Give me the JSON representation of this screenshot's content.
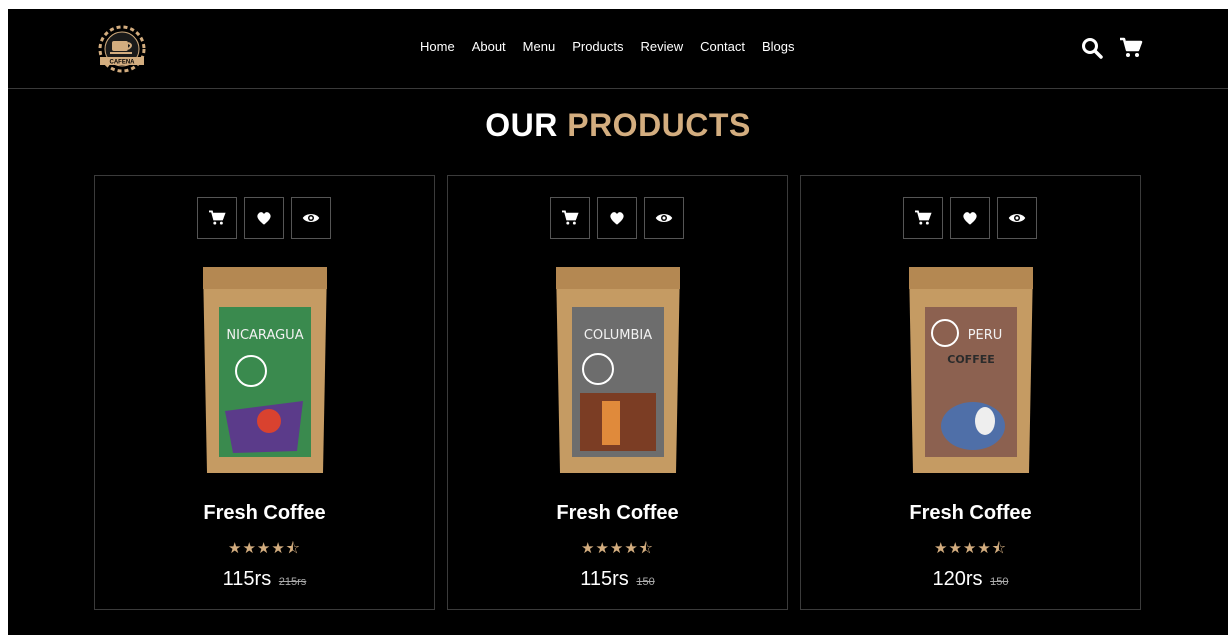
{
  "header": {
    "logo_text": "CAFENA",
    "nav": [
      "Home",
      "About",
      "Menu",
      "Products",
      "Review",
      "Contact",
      "Blogs"
    ]
  },
  "section": {
    "title_part1": "OUR",
    "title_part2": "PRODUCTS"
  },
  "products": [
    {
      "name": "Fresh Coffee",
      "price": "115rs",
      "old_price": "215rs",
      "rating_stars": "★★★★⯪",
      "bag_label": "NICARAGUA",
      "bag_color": "#3a8a4e"
    },
    {
      "name": "Fresh Coffee",
      "price": "115rs",
      "old_price": "150",
      "rating_stars": "★★★★⯪",
      "bag_label": "COLUMBIA",
      "bag_color": "#6d6d6d"
    },
    {
      "name": "Fresh Coffee",
      "price": "120rs",
      "old_price": "150",
      "rating_stars": "★★★★⯪",
      "bag_label": "PERU",
      "bag_color": "#8c6150"
    }
  ],
  "colors": {
    "accent": "#d3ad7f",
    "background": "#000000",
    "border": "#3b3b3b"
  }
}
